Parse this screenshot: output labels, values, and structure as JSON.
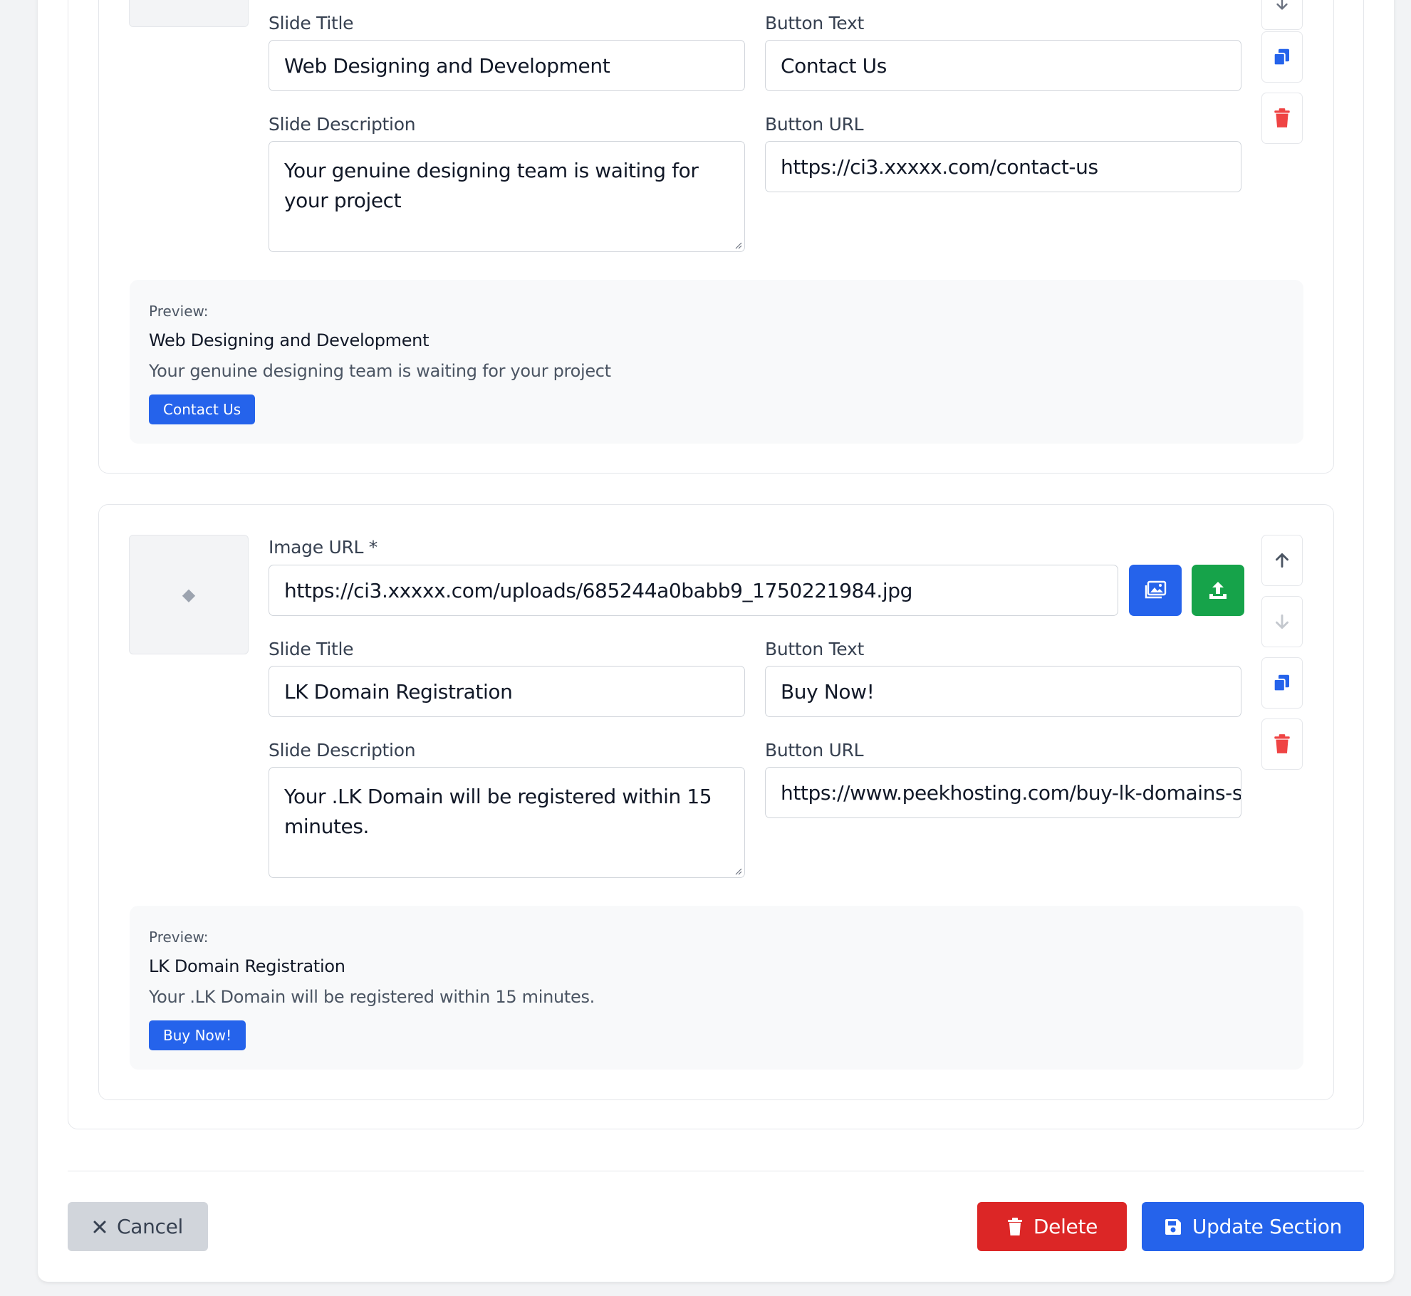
{
  "slides": [
    {
      "slide_title_label": "Slide Title",
      "slide_title_value": "Web Designing and Development",
      "button_text_label": "Button Text",
      "button_text_value": "Contact Us",
      "slide_desc_label": "Slide Description",
      "slide_desc_value": "Your genuine designing team is waiting for your project",
      "button_url_label": "Button URL",
      "button_url_value": "https://ci3.xxxxx.com/contact-us",
      "preview_label": "Preview:",
      "preview_title": "Web Designing and Development",
      "preview_desc": "Your genuine designing team is waiting for your project",
      "preview_button": "Contact Us"
    },
    {
      "image_url_label": "Image URL *",
      "image_url_value": "https://ci3.xxxxx.com/uploads/685244a0babb9_1750221984.jpg",
      "thumb_placeholder": "◆",
      "slide_title_label": "Slide Title",
      "slide_title_value": "LK Domain Registration",
      "button_text_label": "Button Text",
      "button_text_value": "Buy Now!",
      "slide_desc_label": "Slide Description",
      "slide_desc_value": "Your .LK Domain will be registered within 15 minutes.",
      "button_url_label": "Button URL",
      "button_url_value": "https://www.peekhosting.com/buy-lk-domains-sri-",
      "preview_label": "Preview:",
      "preview_title": "LK Domain Registration",
      "preview_desc": "Your .LK Domain will be registered within 15 minutes.",
      "preview_button": "Buy Now!"
    }
  ],
  "footer": {
    "cancel_label": "Cancel",
    "delete_label": "Delete",
    "update_label": "Update Section"
  },
  "colors": {
    "primary": "#2563eb",
    "success": "#16a34a",
    "danger": "#dc2626",
    "cancel_bg": "#d1d5db"
  }
}
